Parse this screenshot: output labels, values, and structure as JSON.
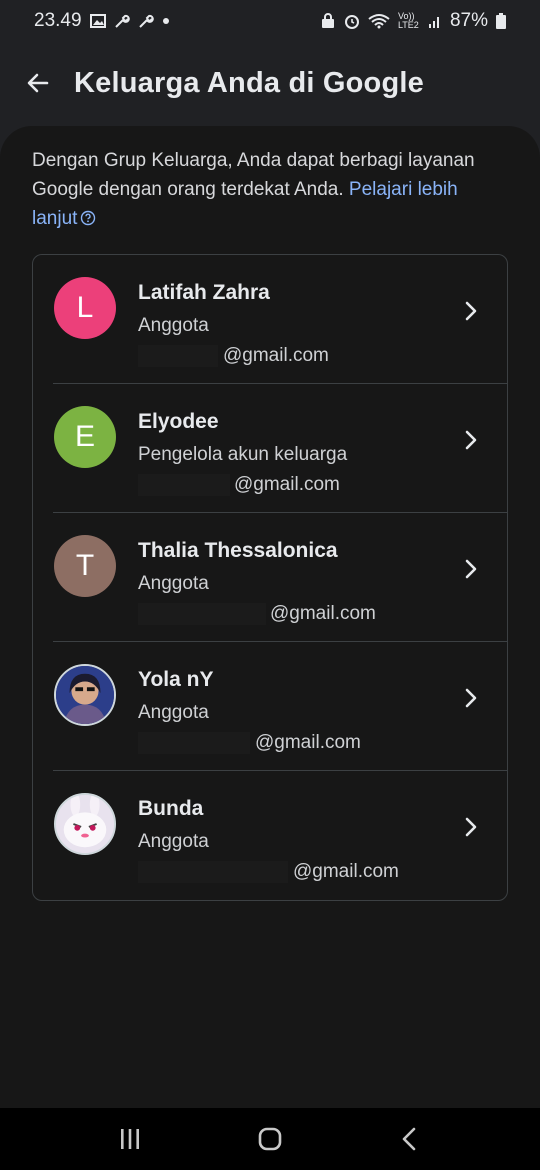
{
  "status": {
    "time": "23.49",
    "battery": "87%",
    "net": "Vo)) LTE2"
  },
  "appbar": {
    "title": "Keluarga Anda di Google"
  },
  "intro": {
    "text": "Dengan Grup Keluarga, Anda dapat berbagi layanan Google dengan orang terdekat Anda.",
    "link": "Pelajari lebih lanjut"
  },
  "members": [
    {
      "initial": "L",
      "name": "Latifah Zahra",
      "role": "Anggota",
      "email": "@gmail.com",
      "color": "#ec407a"
    },
    {
      "initial": "E",
      "name": "Elyodee",
      "role": "Pengelola akun keluarga",
      "email": "@gmail.com",
      "color": "#7cb342"
    },
    {
      "initial": "T",
      "name": "Thalia Thessalonica",
      "role": "Anggota",
      "email": "@gmail.com",
      "color": "#8d6e63"
    },
    {
      "initial": "",
      "name": "Yola nY",
      "role": "Anggota",
      "email": "@gmail.com",
      "color": "#1a237e"
    },
    {
      "initial": "",
      "name": "Bunda",
      "role": "Anggota",
      "email": "@gmail.com",
      "color": "#e0d8e8"
    }
  ],
  "icons": {
    "back": "arrow-back-icon",
    "chevron": "chevron-right-icon",
    "help": "help-circle-icon"
  }
}
